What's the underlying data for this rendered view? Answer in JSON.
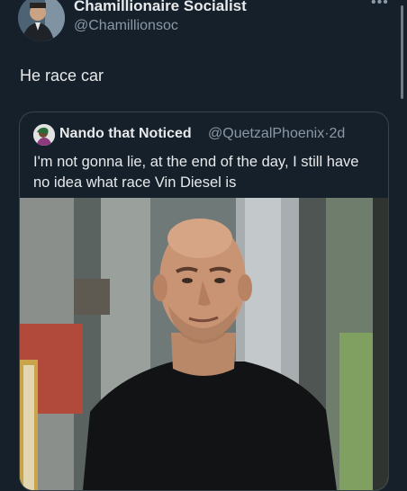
{
  "tweet": {
    "author_name": "Chamillionaire Socialist",
    "author_handle": "@Chamillionsoc",
    "text": "He race car",
    "more_icon": "more-horizontal-icon"
  },
  "quoted_tweet": {
    "author_name": "Nando that Noticed",
    "author_handle": "@QuetzalPhoenix",
    "separator": "·",
    "time": "2d",
    "text": "I'm not gonna lie, at the end of the day, I still have no idea what race Vin Diesel is",
    "media": "photo of a bald man in a black t-shirt on a city street"
  },
  "colors": {
    "background": "#15202b",
    "text": "#e7e9ea",
    "secondary": "#8b98a5",
    "border": "#38444d"
  }
}
